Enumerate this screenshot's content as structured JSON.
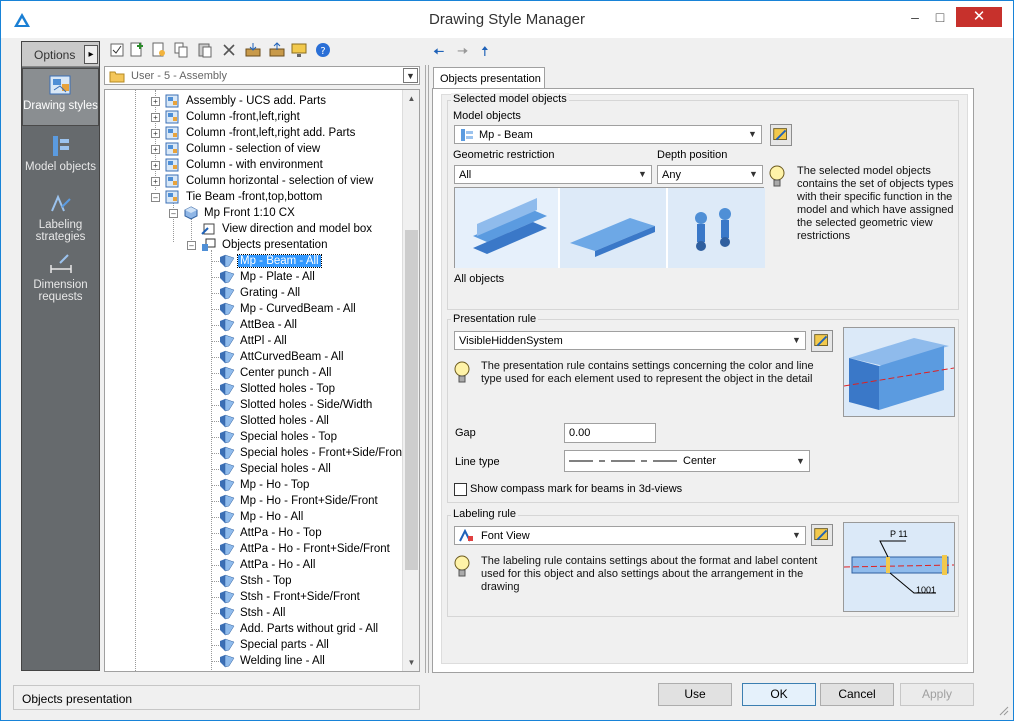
{
  "window": {
    "title": "Drawing Style Manager"
  },
  "rail": {
    "options_label": "Options",
    "items": [
      {
        "label": "Drawing styles"
      },
      {
        "label": "Model objects"
      },
      {
        "label": "Labeling strategies"
      },
      {
        "label": "Dimension requests"
      }
    ]
  },
  "location_combo": {
    "value": "User - 5 - Assembly"
  },
  "tree": {
    "top_items": [
      "Assembly - UCS add. Parts",
      "Column -front,left,right",
      "Column -front,left,right add. Parts",
      "Column - selection of view",
      "Column - with environment",
      "Column horizontal - selection of view",
      "Tie Beam -front,top,bottom"
    ],
    "view_item": "Mp Front 1:10 CX",
    "view_children": [
      "View direction and model box",
      "Objects presentation"
    ],
    "objects": [
      "Mp - Beam - All",
      "Mp - Plate - All",
      "Grating - All",
      "Mp - CurvedBeam - All",
      "AttBea - All",
      "AttPl - All",
      "AttCurvedBeam - All",
      "Center punch - All",
      "Slotted holes - Top",
      "Slotted holes - Side/Width",
      "Slotted holes - All",
      "Special holes - Top",
      "Special holes - Front+Side/Front",
      "Special holes - All",
      "Mp - Ho - Top",
      "Mp - Ho - Front+Side/Front",
      "Mp - Ho - All",
      "AttPa - Ho - Top",
      "AttPa - Ho - Front+Side/Front",
      "AttPa - Ho - All",
      "Stsh - Top",
      "Stsh - Front+Side/Front",
      "Stsh - All",
      "Add. Parts without grid - All",
      "Special parts - All",
      "Welding line - All"
    ]
  },
  "tab": {
    "label": "Objects presentation"
  },
  "selected_model_objects": {
    "group_label": "Selected model objects",
    "model_objects_label": "Model objects",
    "model_objects_value": "Mp - Beam",
    "geo_label": "Geometric restriction",
    "geo_value": "All",
    "depth_label": "Depth position",
    "depth_value": "Any",
    "info": "The selected model objects contains the set of objects types with their specific function in the model and which have assigned the selected geometric view restrictions",
    "preview_caption": "All objects"
  },
  "presentation_rule": {
    "group_label": "Presentation rule",
    "value": "VisibleHiddenSystem",
    "info": "The presentation rule contains settings concerning the color and line type used for each element used to represent the object in the detail",
    "gap_label": "Gap",
    "gap_value": "0.00",
    "linetype_label": "Line type",
    "linetype_value": "Center",
    "compass_label": "Show compass mark for beams in 3d-views"
  },
  "labeling_rule": {
    "group_label": "Labeling rule",
    "value": "Font View",
    "info": "The labeling rule contains settings about the format and label content used for this object and also settings about the arrangement in the drawing",
    "preview_label_top": "P 11",
    "preview_label_bottom": "1001"
  },
  "status": {
    "text": "Objects presentation"
  },
  "buttons": {
    "use": "Use",
    "ok": "OK",
    "cancel": "Cancel",
    "apply": "Apply"
  },
  "colors": {
    "selection": "#3399ff",
    "accent": "#1883d7",
    "close": "#c7312c"
  }
}
